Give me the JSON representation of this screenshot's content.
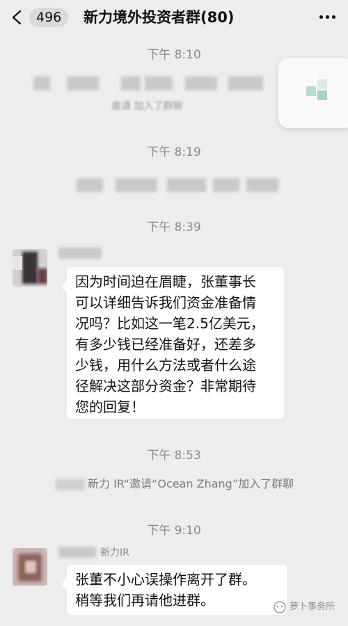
{
  "header": {
    "unread_count": "496",
    "title": "新力境外投资者群(80)"
  },
  "timestamps": {
    "t1": "下午 8:10",
    "t2": "下午 8:19",
    "t3": "下午 8:39",
    "t4": "下午 8:53",
    "t5": "下午 9:10"
  },
  "system": {
    "blurred_join_text": "邀请 加入了群聊",
    "invite_sender": "新力 IR",
    "invite_text": "“邀请“Ocean Zhang”加入了群聊"
  },
  "messages": [
    {
      "sender": "",
      "text": "因为时间迫在眉睫，张董事长\n可以详细告诉我们资金准备情\n况吗？比如这一笔2.5亿美元，\n有多少钱已经准备好，还差多\n少钱，用什么方法或者什么途\n径解决这部分资金？非常期待\n您的回复！"
    },
    {
      "sender": "新力IR",
      "text": "张董不小心误操作离开了群。\n稍等我们再请他进群。"
    }
  ],
  "watermark": {
    "text": "萝卜事务所"
  },
  "colors": {
    "background": "#ededed",
    "bubble": "#ffffff",
    "timestamp": "#8a8a8a"
  },
  "icons": [
    "back-chevron-icon",
    "more-dots-icon",
    "watermark-logo-icon"
  ]
}
